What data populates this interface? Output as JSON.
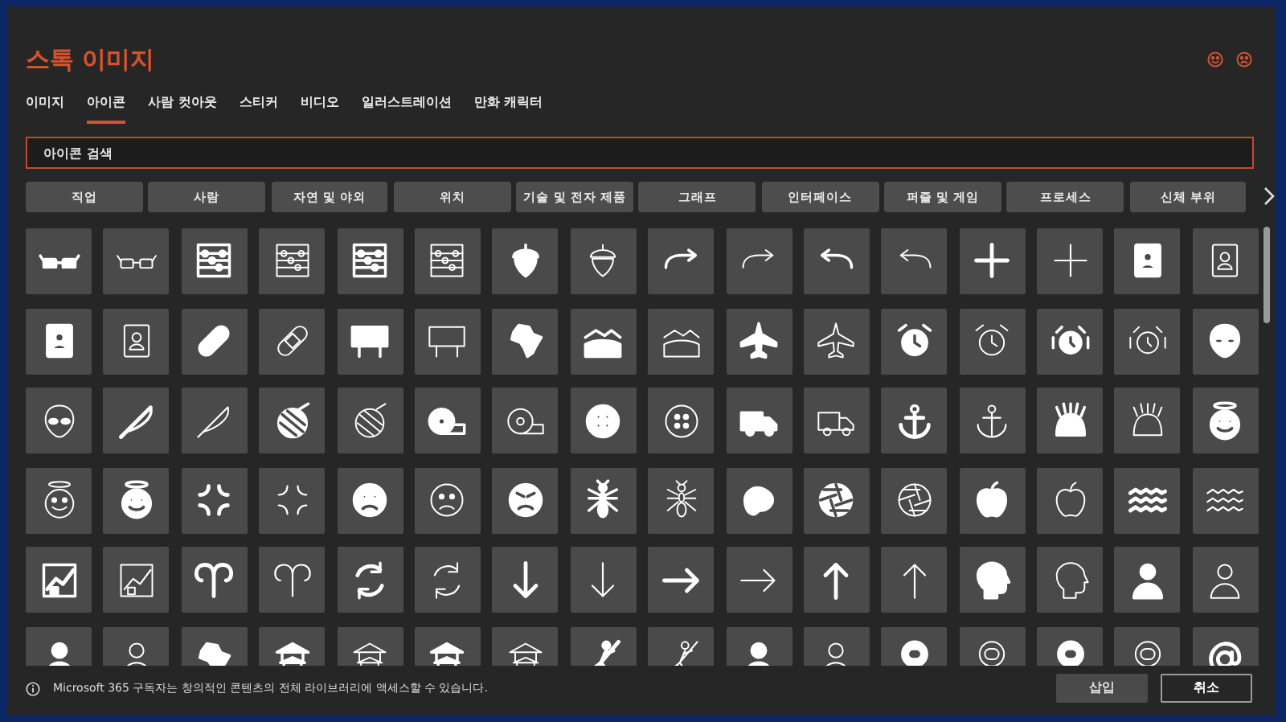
{
  "title": "스톡 이미지",
  "tabs": [
    {
      "label": "이미지",
      "selected": false
    },
    {
      "label": "아이콘",
      "selected": true
    },
    {
      "label": "사람 컷아웃",
      "selected": false
    },
    {
      "label": "스티커",
      "selected": false
    },
    {
      "label": "비디오",
      "selected": false
    },
    {
      "label": "일러스트레이션",
      "selected": false
    },
    {
      "label": "만화 캐릭터",
      "selected": false
    }
  ],
  "search": {
    "placeholder": "아이콘 검색"
  },
  "categories": [
    "직업",
    "사람",
    "자연 및 야외",
    "위치",
    "기술 및 전자 제품",
    "그래프",
    "인터페이스",
    "퍼즐 및 게임",
    "프로세스",
    "신체 부위"
  ],
  "notice": "Microsoft 365 구독자는 창의적인 콘텐츠의 전체 라이브러리에 액세스할 수 있습니다.",
  "buttons": [
    {
      "label": "삽입",
      "disabled": true
    },
    {
      "label": "취소",
      "disabled": false
    }
  ]
}
